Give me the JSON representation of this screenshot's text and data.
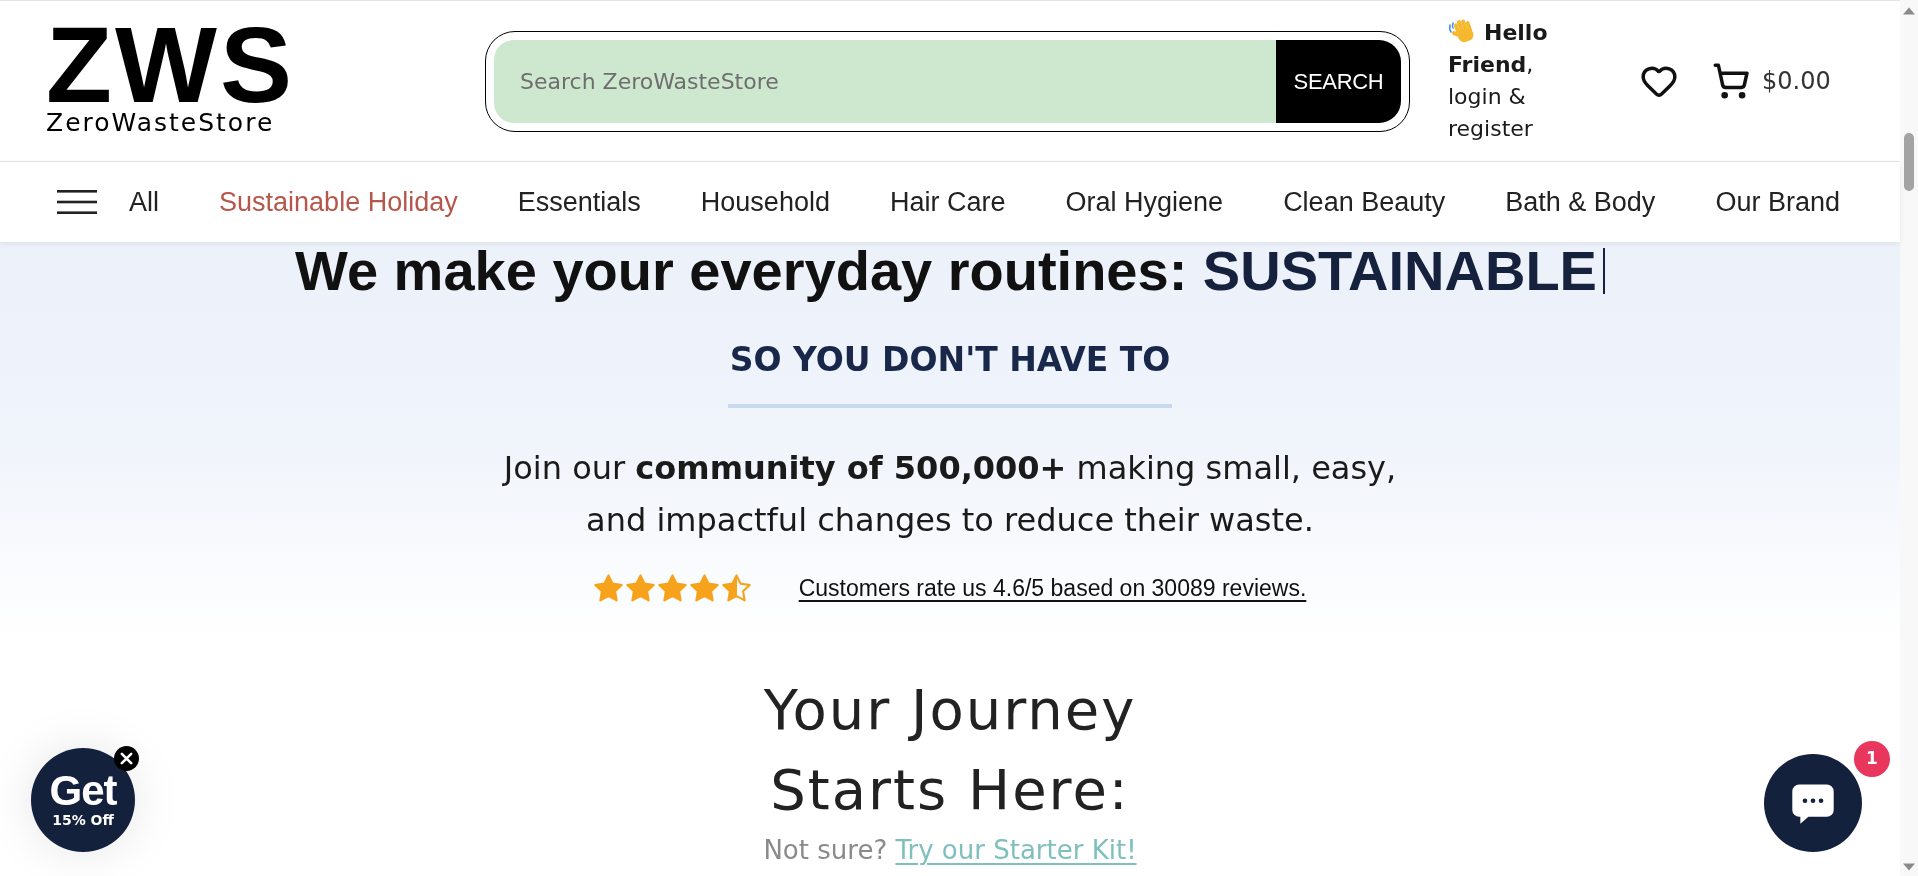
{
  "header": {
    "logo": {
      "mark": "ZWS",
      "name": "ZeroWasteStore"
    },
    "search": {
      "placeholder": "Search ZeroWasteStore",
      "button": "SEARCH"
    },
    "account": {
      "greeting": "**Hello Friend**, login & register"
    },
    "cart": {
      "total": "$0.00"
    }
  },
  "nav": {
    "all_label": "All",
    "items": [
      {
        "label": "Sustainable Holiday",
        "color": "#b5574a"
      },
      {
        "label": "Essentials",
        "color": "#222222"
      },
      {
        "label": "Household",
        "color": "#222222"
      },
      {
        "label": "Hair Care",
        "color": "#222222"
      },
      {
        "label": "Oral Hygiene",
        "color": "#222222"
      },
      {
        "label": "Clean Beauty",
        "color": "#222222"
      },
      {
        "label": "Bath & Body",
        "color": "#222222"
      },
      {
        "label": "Our Brand",
        "color": "#222222"
      }
    ]
  },
  "hero": {
    "headline": {
      "lead": "We make your everyday routines:",
      "highlight": "SUSTAINABLE"
    },
    "subheading": "SO YOU DON'T HAVE TO",
    "intro": "Join our **community of 500,000+** making small, easy, and impactful changes to reduce their waste.",
    "rating": {
      "stars": 4.5,
      "text": "Customers rate us 4.6/5 based on 30089 reviews."
    }
  },
  "journey": {
    "title": "Your Journey Starts Here:",
    "prompt": "Not sure?",
    "link": "Try our Starter Kit!"
  },
  "discount_bubble": {
    "title": "Get",
    "subtitle": "15% Off"
  },
  "chat": {
    "badge": "1"
  }
}
